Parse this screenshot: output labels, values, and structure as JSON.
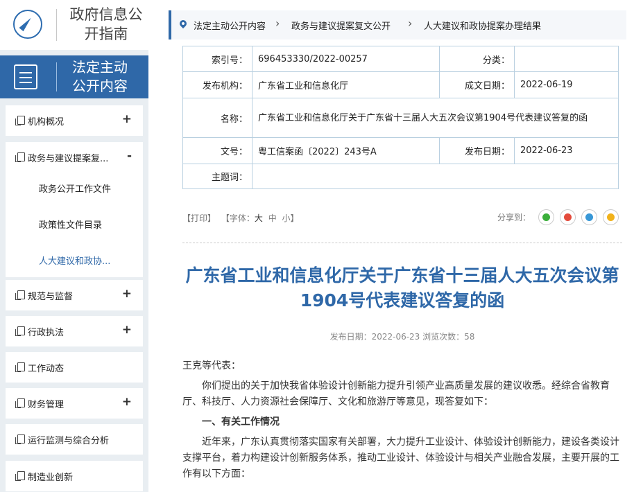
{
  "sidebar": {
    "header1": {
      "title": "政府信息公开指南",
      "icon": "compass-icon"
    },
    "header2": {
      "title": "法定主动公开内容",
      "icon": "document-icon"
    },
    "items": [
      {
        "label": "机构概况",
        "toggle": "+"
      },
      {
        "label": "政务与建议提案复...",
        "toggle": "-"
      },
      {
        "label": "规范与监督",
        "toggle": "+"
      },
      {
        "label": "行政执法",
        "toggle": "+"
      },
      {
        "label": "工作动态",
        "toggle": ""
      },
      {
        "label": "财务管理",
        "toggle": "+"
      },
      {
        "label": "运行监测与综合分析",
        "toggle": ""
      },
      {
        "label": "制造业创新",
        "toggle": ""
      }
    ],
    "subitems": [
      {
        "label": "政务公开工作文件"
      },
      {
        "label": "政策性文件目录"
      },
      {
        "label": "人大建议和政协..."
      }
    ]
  },
  "breadcrumb": [
    "法定主动公开内容",
    "政务与建议提案复文公开",
    "人大建议和政协提案办理结果"
  ],
  "meta": {
    "index_label": "索引号：",
    "index_value": "696453330/2022-00257",
    "category_label": "分类：",
    "category_value": "",
    "issuer_label": "发布机构：",
    "issuer_value": "广东省工业和信息化厅",
    "created_label": "成文日期：",
    "created_value": "2022-06-19",
    "name_label": "名称：",
    "name_value": "广东省工业和信息化厅关于广东省十三届人大五次会议第1904号代表建议答复的函",
    "docno_label": "文号：",
    "docno_value": "粤工信案函〔2022〕243号A",
    "published_label": "发布日期：",
    "published_value": "2022-06-23",
    "keywords_label": "主题词：",
    "keywords_value": ""
  },
  "tools": {
    "print": "【打印】",
    "font_prefix": "【字体：",
    "font_large": "大",
    "font_medium": "中",
    "font_small": "小",
    "font_suffix": "】",
    "share_label": "分享到："
  },
  "article": {
    "title": "广东省工业和信息化厅关于广东省十三届人大五次会议第1904号代表建议答复的函",
    "meta": "发布日期：2022-06-23  浏览次数：58",
    "salutation": "王克等代表：",
    "para1": "你们提出的关于加快我省体验设计创新能力提升引领产业高质量发展的建议收悉。经综合省教育厅、科技厅、人力资源社会保障厅、文化和旅游厅等意见，现答复如下：",
    "heading1": "一、有关工作情况",
    "para2": "近年来，广东认真贯彻落实国家有关部署，大力提升工业设计、体验设计创新能力，建设各类设计支撑平台，着力构建设计创新服务体系，推动工业设计、体验设计与相关产业融合发展，主要开展的工作有以下方面："
  }
}
